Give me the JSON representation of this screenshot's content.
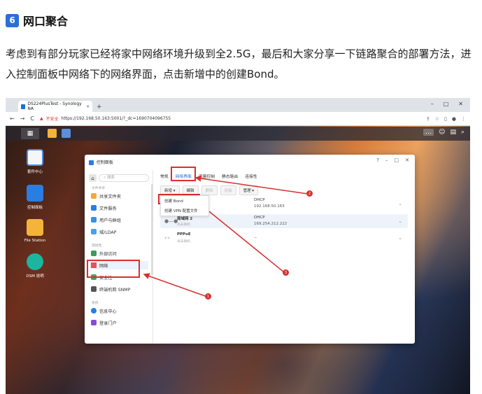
{
  "article": {
    "section_number": "6",
    "title": "网口聚合",
    "paragraph": "考虑到有部分玩家已经将家中网络环境升级到全2.5G，最后和大家分享一下链路聚合的部署方法，进入控制面板中网络下的网络界面，点击新增中的创建Bond。"
  },
  "browser": {
    "tab_title": "DS224PlusTest - Synology NA",
    "tab_close": "×",
    "new_tab": "+",
    "win_min": "–",
    "win_max": "□",
    "win_close": "✕",
    "nav_back": "←",
    "nav_forward": "→",
    "nav_reload": "C",
    "insecure_label": "不安全",
    "url": "https://192.168.50.163:5001/?_dc=1690704096755"
  },
  "desktop": {
    "icons": [
      {
        "label": "套件中心"
      },
      {
        "label": "控制面板"
      },
      {
        "label": "File Station"
      },
      {
        "label": "DSM 说明"
      }
    ]
  },
  "control_panel": {
    "title": "控制面板",
    "window_controls": [
      "?",
      "–",
      "□",
      "✕"
    ],
    "search_placeholder": "搜索",
    "groups": [
      "文件共享",
      "连接性",
      "系统"
    ],
    "items": [
      "共享文件夹",
      "文件服务",
      "用户与群组",
      "域/LDAP",
      "外部访问",
      "网络",
      "安全性",
      "终端机和 SNMP",
      "信息中心",
      "登录门户"
    ],
    "tabs": [
      "常规",
      "网络界面",
      "流量控制",
      "静态路由",
      "连接性"
    ],
    "toolbar": {
      "new": "新增 ▾",
      "edit": "编辑",
      "delete": "删除",
      "connect": "连接",
      "manage": "管理 ▾"
    },
    "menu": [
      "创建 Bond",
      "创建 VPN 配置文件"
    ],
    "interfaces": [
      {
        "name": "",
        "status": "",
        "type": "DHCP",
        "ip": "192.168.50.163"
      },
      {
        "name": "局域网 2",
        "status": "尚未联机",
        "type": "DHCP",
        "ip": "169.254.212.222"
      },
      {
        "name": "PPPoE",
        "status": "尚未联机",
        "type": "",
        "ip": "--"
      }
    ]
  },
  "annotations": [
    "1",
    "2",
    "3"
  ],
  "colors": {
    "highlight": "#d92f2f",
    "accent": "#1e6ed8",
    "badge": "#2a6fdb"
  }
}
